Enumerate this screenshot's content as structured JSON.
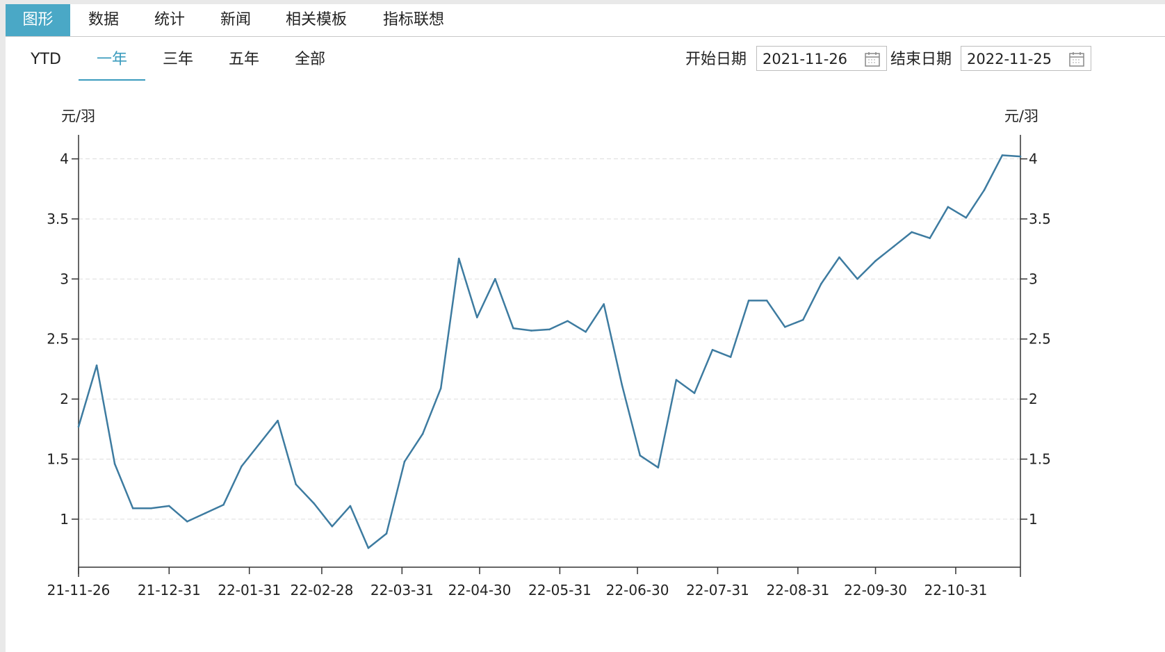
{
  "tabs": [
    {
      "label": "图形",
      "active": true
    },
    {
      "label": "数据",
      "active": false
    },
    {
      "label": "统计",
      "active": false
    },
    {
      "label": "新闻",
      "active": false
    },
    {
      "label": "相关模板",
      "active": false
    },
    {
      "label": "指标联想",
      "active": false
    }
  ],
  "ranges": [
    {
      "label": "YTD",
      "active": false
    },
    {
      "label": "一年",
      "active": true
    },
    {
      "label": "三年",
      "active": false
    },
    {
      "label": "五年",
      "active": false
    },
    {
      "label": "全部",
      "active": false
    }
  ],
  "date_filter": {
    "start_label": "开始日期",
    "start_value": "2021-11-26",
    "end_label": "结束日期",
    "end_value": "2022-11-25"
  },
  "colors": {
    "accent": "#4aa8c6",
    "line": "#3d7ba0",
    "grid": "#dddddd"
  },
  "chart_data": {
    "type": "line",
    "yunit_left": "元/羽",
    "yunit_right": "元/羽",
    "ylim": [
      0.6,
      4.2
    ],
    "yticks": [
      1,
      1.5,
      2,
      2.5,
      3,
      3.5,
      4
    ],
    "ytick_labels": [
      "1",
      "1.5",
      "2",
      "2.5",
      "3",
      "3.5",
      "4"
    ],
    "xlim": [
      "2021-11-26",
      "2022-11-25"
    ],
    "xticks": [
      {
        "date": "2021-11-26",
        "label": "21-11-26"
      },
      {
        "date": "2021-12-31",
        "label": "21-12-31"
      },
      {
        "date": "2022-01-31",
        "label": "22-01-31"
      },
      {
        "date": "2022-02-28",
        "label": "22-02-28"
      },
      {
        "date": "2022-03-31",
        "label": "22-03-31"
      },
      {
        "date": "2022-04-30",
        "label": "22-04-30"
      },
      {
        "date": "2022-05-31",
        "label": "22-05-31"
      },
      {
        "date": "2022-06-30",
        "label": "22-06-30"
      },
      {
        "date": "2022-07-31",
        "label": "22-07-31"
      },
      {
        "date": "2022-08-31",
        "label": "22-08-31"
      },
      {
        "date": "2022-09-30",
        "label": "22-09-30"
      },
      {
        "date": "2022-10-31",
        "label": "22-10-31"
      }
    ],
    "grid": true,
    "series": [
      {
        "x": [
          "2021-11-26",
          "2021-12-03",
          "2021-12-10",
          "2021-12-17",
          "2021-12-24",
          "2021-12-31",
          "2022-01-07",
          "2022-01-14",
          "2022-01-21",
          "2022-01-28",
          "2022-02-04",
          "2022-02-11",
          "2022-02-18",
          "2022-02-25",
          "2022-03-04",
          "2022-03-11",
          "2022-03-18",
          "2022-03-25",
          "2022-04-01",
          "2022-04-08",
          "2022-04-15",
          "2022-04-22",
          "2022-04-29",
          "2022-05-06",
          "2022-05-13",
          "2022-05-20",
          "2022-05-27",
          "2022-06-03",
          "2022-06-10",
          "2022-06-17",
          "2022-06-24",
          "2022-07-01",
          "2022-07-08",
          "2022-07-15",
          "2022-07-22",
          "2022-07-29",
          "2022-08-05",
          "2022-08-12",
          "2022-08-19",
          "2022-08-26",
          "2022-09-02",
          "2022-09-09",
          "2022-09-16",
          "2022-09-23",
          "2022-09-30",
          "2022-10-07",
          "2022-10-14",
          "2022-10-21",
          "2022-10-28",
          "2022-11-04",
          "2022-11-11",
          "2022-11-18",
          "2022-11-25"
        ],
        "values": [
          1.77,
          2.28,
          1.46,
          1.09,
          1.09,
          1.11,
          0.98,
          1.05,
          1.12,
          1.44,
          1.63,
          1.82,
          1.29,
          1.13,
          0.94,
          1.11,
          0.76,
          0.88,
          1.48,
          1.71,
          2.09,
          3.17,
          2.68,
          3.0,
          2.59,
          2.57,
          2.58,
          2.65,
          2.56,
          2.79,
          2.12,
          1.53,
          1.43,
          2.16,
          2.05,
          2.41,
          2.35,
          2.82,
          2.82,
          2.6,
          2.66,
          2.96,
          3.18,
          3.0,
          3.15,
          3.27,
          3.39,
          3.34,
          3.6,
          3.51,
          3.74,
          4.03,
          4.02
        ]
      }
    ]
  }
}
